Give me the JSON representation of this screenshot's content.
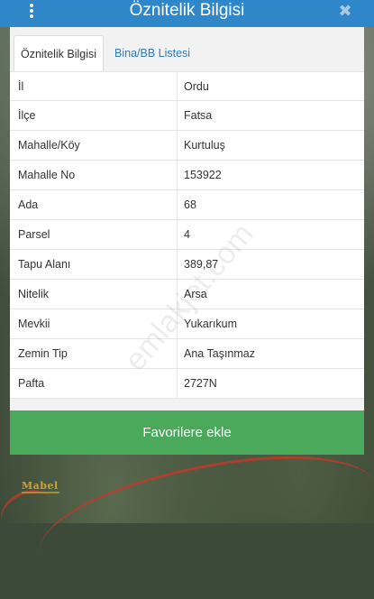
{
  "header": {
    "title": "Öznitelik Bilgisi",
    "close_glyph": "✖"
  },
  "tabs": [
    {
      "label": "Öznitelik Bilgisi",
      "active": true
    },
    {
      "label": "Bina/BB Listesi",
      "active": false
    }
  ],
  "rows": [
    {
      "label": "İl",
      "value": "Ordu"
    },
    {
      "label": "İlçe",
      "value": "Fatsa"
    },
    {
      "label": "Mahalle/Köy",
      "value": "Kurtuluş"
    },
    {
      "label": "Mahalle No",
      "value": "153922"
    },
    {
      "label": "Ada",
      "value": "68"
    },
    {
      "label": "Parsel",
      "value": "4"
    },
    {
      "label": "Tapu Alanı",
      "value": "389,87"
    },
    {
      "label": "Nitelik",
      "value": "Arsa"
    },
    {
      "label": "Mevkii",
      "value": "Yukarıkum"
    },
    {
      "label": "Zemin Tip",
      "value": "Ana Taşınmaz"
    },
    {
      "label": "Pafta",
      "value": "2727N"
    }
  ],
  "actions": {
    "favorite_label": "Favorilere ekle"
  },
  "watermark": "emlakjet.com",
  "map": {
    "logo": "Mabel"
  },
  "icons": {
    "menu": "kebab-menu-icon",
    "close": "close-icon"
  },
  "colors": {
    "header": "#2f86c9",
    "tab_link": "#2f7bbd",
    "button": "#4aa95b",
    "road": "#c0392b"
  }
}
